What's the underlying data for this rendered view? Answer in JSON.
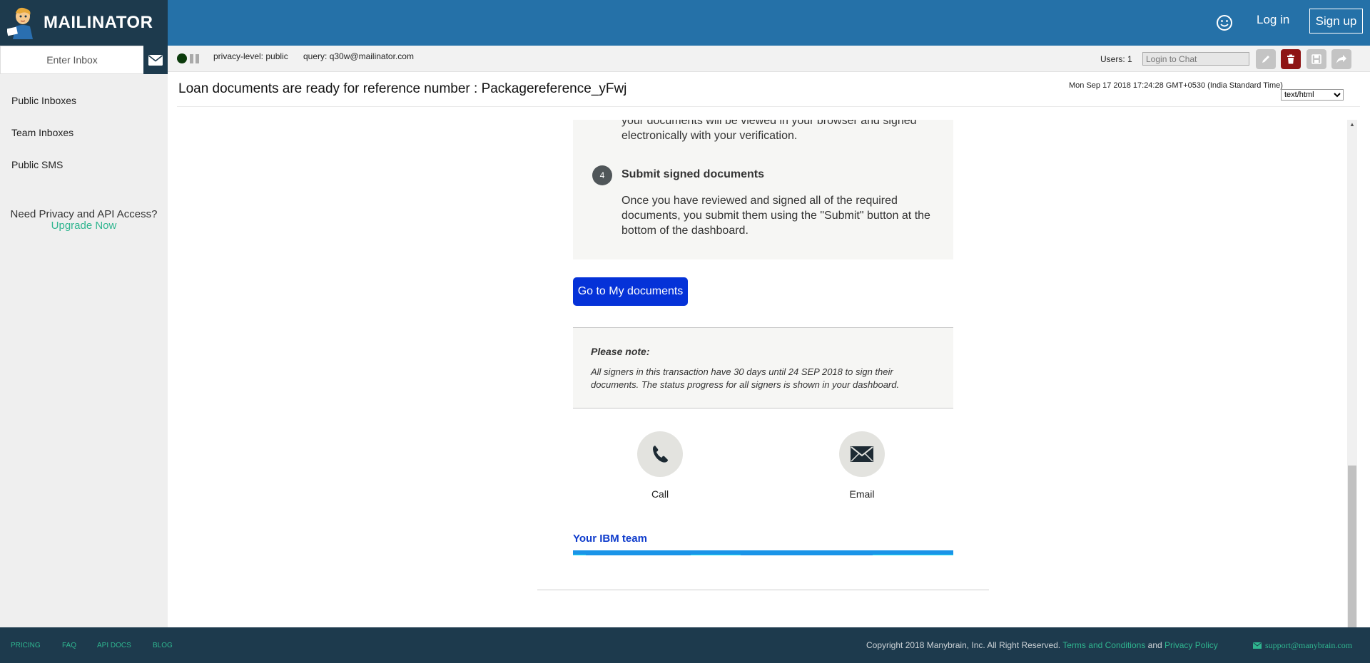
{
  "app": {
    "brand": "MAILINATOR"
  },
  "sidebar": {
    "inbox_placeholder": "Enter Inbox",
    "items": [
      {
        "label": "Public Inboxes"
      },
      {
        "label": "Team Inboxes"
      },
      {
        "label": "Public SMS"
      }
    ],
    "upgrade_text": "Need Privacy and API Access?",
    "upgrade_link": "Upgrade Now"
  },
  "header": {
    "login": "Log in",
    "signup": "Sign up"
  },
  "statusbar": {
    "privacy_label": "privacy-level:",
    "privacy_value": "public",
    "query_label": "query:",
    "query_value": "q30w@mailinator.com",
    "users": "Users: 1",
    "chat_placeholder": "Login to Chat"
  },
  "message": {
    "subject": "Loan documents are ready for reference number : Packagereference_yFwj",
    "date": "Mon Sep 17 2018 17:24:28 GMT+0530 (India Standard Time)",
    "format": "text/html"
  },
  "email": {
    "step3_tail": "your documents will be viewed in your browser and signed electronically with your verification.",
    "step4_number": "4",
    "step4_title": "Submit signed documents",
    "step4_body": "Once you have reviewed and signed all of the required documents, you submit them using the \"Submit\" button at the bottom of the dashboard.",
    "button": "Go to My documents",
    "note_title": "Please note:",
    "note_body": "All signers in this transaction have 30 days until 24 SEP 2018 to sign their documents. The status progress for all signers is shown in your dashboard.",
    "call_label": "Call",
    "email_label": "Email",
    "team": "Your IBM team"
  },
  "footer": {
    "links": [
      "PRICING",
      "FAQ",
      "API DOCS",
      "BLOG"
    ],
    "copyright": "Copyright 2018 Manybrain, Inc. All Right Reserved.",
    "terms": "Terms and Conditions",
    "and": "and",
    "privacy": "Privacy Policy",
    "support": "support@manybrain.com"
  },
  "colors": {
    "sidebar_dark": "#1d3a4d",
    "header_blue": "#2571a8",
    "accent_green": "#2fb58f",
    "cta_blue": "#0532d8",
    "delete_red": "#8e1414"
  }
}
